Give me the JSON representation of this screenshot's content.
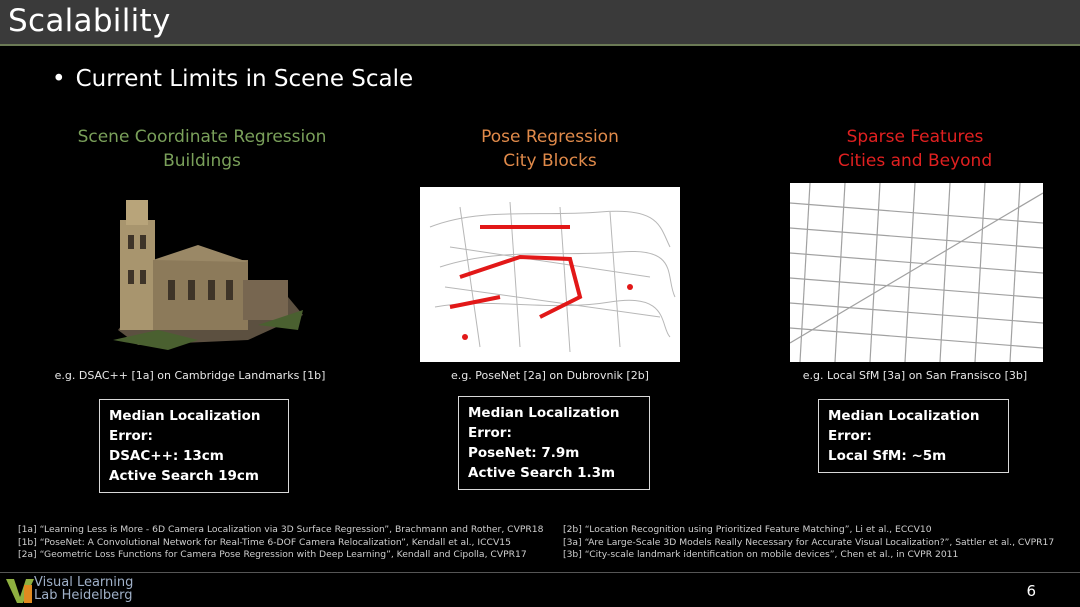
{
  "slide": {
    "title": "Scalability",
    "bullet": "Current Limits in Scene Scale",
    "bullet_marker": "•",
    "page_number": "6"
  },
  "columns": [
    {
      "heading_line1": "Scene Coordinate Regression",
      "heading_line2": "Buildings",
      "heading_color": "#7aa05a",
      "caption": "e.g. DSAC++ [1a] on Cambridge Landmarks [1b]",
      "box_lines": [
        "Median Localization Error:",
        "DSAC++: 13cm",
        "Active Search 19cm"
      ]
    },
    {
      "heading_line1": "Pose Regression",
      "heading_line2": "City Blocks",
      "heading_color": "#e08a4a",
      "caption": "e.g. PoseNet [2a] on Dubrovnik [2b]",
      "box_lines": [
        "Median Localization Error:",
        "PoseNet: 7.9m",
        "Active Search 1.3m"
      ]
    },
    {
      "heading_line1": "Sparse Features",
      "heading_line2": "Cities and Beyond",
      "heading_color": "#e02020",
      "caption": "e.g. Local SfM [3a] on San Fransisco [3b]",
      "box_lines": [
        "Median Localization Error:",
        "Local SfM: ~5m"
      ]
    }
  ],
  "references_left": [
    "[1a] “Learning Less is More - 6D Camera Localization via 3D Surface Regression”, Brachmann and Rother, CVPR18",
    "[1b] “PoseNet: A Convolutional Network for Real-Time 6-DOF Camera Relocalization”, Kendall et al., ICCV15",
    "[2a] “Geometric Loss Functions for Camera Pose Regression with Deep Learning”, Kendall and Cipolla, CVPR17"
  ],
  "references_right": [
    "[2b] “Location Recognition using Prioritized Feature Matching”, Li et al., ECCV10",
    "[3a] “Are Large-Scale 3D Models Really Necessary for Accurate Visual Localization?”, Sattler et al., CVPR17",
    "[3b] “City-scale landmark identification on mobile devices”, Chen et al., in CVPR 2011"
  ],
  "logo": {
    "line1": "Visual Learning",
    "line2": "Lab Heidelberg"
  }
}
